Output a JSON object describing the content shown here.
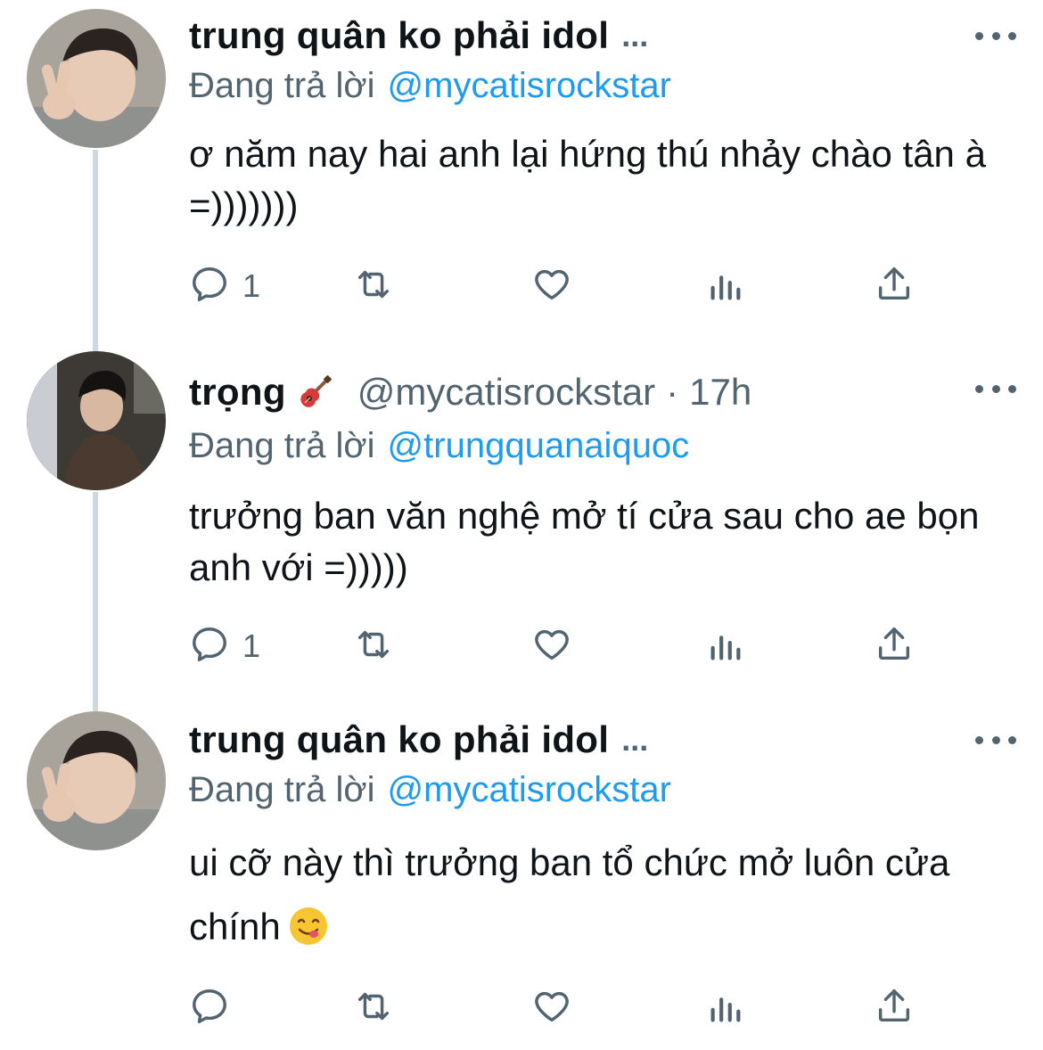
{
  "tweets": [
    {
      "name": "trung quân ko phải idol",
      "name_suffix": "...",
      "reply_label": "Đang trả lời",
      "reply_to": "@mycatisrockstar",
      "text": "ơ năm nay hai anh lại hứng thú nhảy chào tân à =)))))))",
      "reply_count": "1",
      "icons": [
        "reply-icon",
        "retweet-icon",
        "like-icon",
        "analytics-icon",
        "share-icon"
      ]
    },
    {
      "name": "trọng",
      "name_emoji": "guitar-emoji",
      "handle": "@mycatisrockstar",
      "dot": "·",
      "time": "17h",
      "reply_label": "Đang trả lời",
      "reply_to": "@trungquanaiquoc",
      "text": "trưởng ban văn nghệ mở tí cửa sau cho ae bọn anh với =)))))",
      "reply_count": "1",
      "icons": [
        "reply-icon",
        "retweet-icon",
        "like-icon",
        "analytics-icon",
        "share-icon"
      ]
    },
    {
      "name": "trung quân ko phải idol",
      "name_suffix": "...",
      "reply_label": "Đang trả lời",
      "reply_to": "@mycatisrockstar",
      "text": "ui cỡ này thì trưởng ban tổ chức mở luôn cửa chính",
      "text_emoji": "yum-face-emoji",
      "reply_count": "",
      "icons": [
        "reply-icon",
        "retweet-icon",
        "like-icon",
        "analytics-icon",
        "share-icon"
      ]
    }
  ],
  "colors": {
    "text": "#0f1419",
    "secondary": "#536471",
    "link": "#1d9bf0",
    "thread_line": "#cfd9de"
  }
}
